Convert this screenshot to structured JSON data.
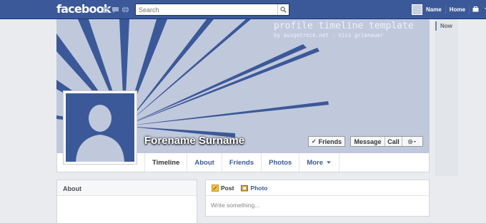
{
  "topbar": {
    "logo": "facebook",
    "search_placeholder": "Search",
    "user_name": "Name",
    "home_label": "Home",
    "icons": [
      "friend-requests-icon",
      "messages-icon",
      "notifications-icon",
      "search-icon",
      "account-icon",
      "settings-icon"
    ]
  },
  "cover": {
    "title": "profile timeline template",
    "subtitle": "by ausgetrock.net - nico grienauer",
    "background_color": "#c0c8dc",
    "ray_color": "#3b5998"
  },
  "profile": {
    "name": "Forename Surname",
    "buttons": {
      "friends": "Friends",
      "message": "Message",
      "call": "Call"
    }
  },
  "tabs": [
    "Timeline",
    "About",
    "Friends",
    "Photos",
    "More"
  ],
  "about_box": {
    "title": "About"
  },
  "composer": {
    "post_label": "Post",
    "photo_label": "Photo",
    "placeholder": "Write something..."
  },
  "timeline_nav": {
    "now_label": "Now"
  },
  "colors": {
    "brand": "#3b5998",
    "page_bg": "#e9ebee"
  }
}
